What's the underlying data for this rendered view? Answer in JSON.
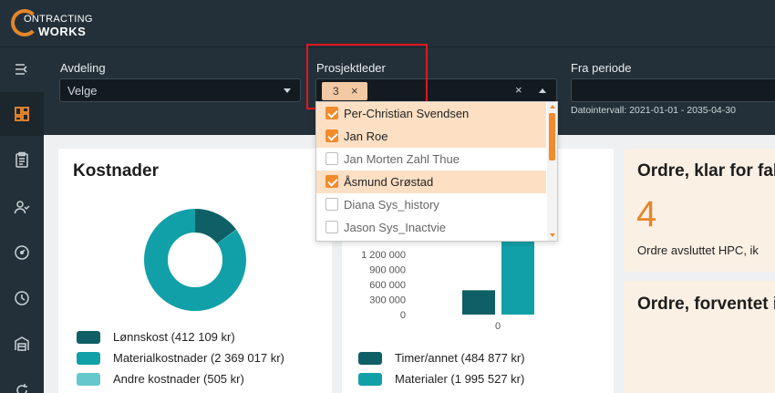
{
  "app": {
    "logo_line1": "ONTRACTING",
    "logo_line2": "WORKS"
  },
  "sidebar": {
    "items": [
      {
        "icon": "menu-collapse-icon"
      },
      {
        "icon": "dashboard-icon",
        "active": true
      },
      {
        "icon": "clipboard-icon"
      },
      {
        "icon": "users-icon"
      },
      {
        "icon": "gauge-icon"
      },
      {
        "icon": "clock-icon"
      },
      {
        "icon": "warehouse-icon"
      },
      {
        "icon": "refresh-icon"
      }
    ]
  },
  "filters": {
    "avdeling": {
      "label": "Avdeling",
      "value": "Velge"
    },
    "prosjektleder": {
      "label": "Prosjektleder",
      "chip_count": "3",
      "chip_remove": "×",
      "clear": "×"
    },
    "fra_periode": {
      "label": "Fra periode",
      "value": "",
      "hint": "Datointervall: 2021-01-01 - 2035-04-30"
    }
  },
  "dropdown": {
    "options": [
      {
        "label": "Per-Christian Svendsen",
        "checked": true
      },
      {
        "label": "Jan Roe",
        "checked": true
      },
      {
        "label": "Jan Morten Zahl Thue",
        "checked": false
      },
      {
        "label": "Åsmund Grøstad",
        "checked": true
      },
      {
        "label": "Diana Sys_history",
        "checked": false
      },
      {
        "label": "Jason Sys_Inactvie",
        "checked": false
      }
    ]
  },
  "kostnader": {
    "title": "Kostnader",
    "legend": [
      {
        "label": "Lønnskost (412 109 kr)",
        "color": "#0f5f66"
      },
      {
        "label": "Materialkostnader (2 369 017 kr)",
        "color": "#12a0a8"
      },
      {
        "label": "Andre kostnader (505 kr)",
        "color": "#66c8cc"
      }
    ]
  },
  "chart_data": {
    "type": "bar",
    "categories": [
      "0"
    ],
    "series": [
      {
        "name": "Timer/annet (484 877 kr)",
        "values": [
          484877
        ],
        "color": "#0f5f66"
      },
      {
        "name": "Materialer (1 995 527 kr)",
        "values": [
          1995527
        ],
        "color": "#12a0a8"
      }
    ],
    "yticks": [
      "1 200 000",
      "900 000",
      "600 000",
      "300 000",
      "0"
    ],
    "ylim": [
      0,
      1500000
    ]
  },
  "ordre_klar": {
    "title": "Ordre, klar for fak",
    "count": "4",
    "subtitle": "Ordre avsluttet HPC, ik"
  },
  "ordre_forventet": {
    "title": "Ordre, forventet i"
  },
  "colors": {
    "accent": "#f28b2b",
    "dark_bg": "#233039",
    "teal_dark": "#0f5f66",
    "teal": "#12a0a8",
    "teal_light": "#66c8cc"
  }
}
